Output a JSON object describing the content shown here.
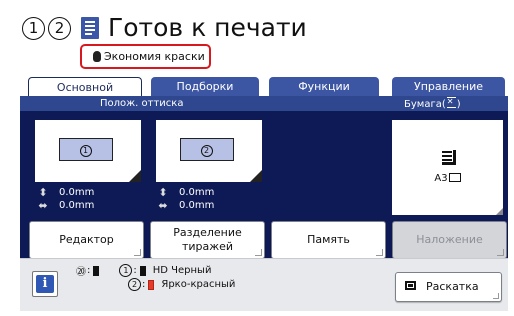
{
  "header": {
    "number_1": "1",
    "number_2": "2",
    "title": "Готов к печати",
    "eco_label": "Экономия краски",
    "doc_icon": "document-lines-icon",
    "eco_icon": "ink-drop-icon"
  },
  "tabs": [
    {
      "label": "Основной",
      "active": true
    },
    {
      "label": "Подборки",
      "active": false
    },
    {
      "label": "Функции",
      "active": false
    },
    {
      "label": "Управление",
      "active": false
    }
  ],
  "panel": {
    "position_header": "Полож. оттиска",
    "paper_header": "Бумага(",
    "paper_header_end": ")",
    "drum_1": {
      "number": "1",
      "vertical_offset": "0.0mm",
      "horizontal_offset": "0.0mm"
    },
    "drum_2": {
      "number": "2",
      "vertical_offset": "0.0mm",
      "horizontal_offset": "0.0mm"
    },
    "paper_size": "A3"
  },
  "buttons": [
    {
      "label": "Редактор",
      "enabled": true
    },
    {
      "label": "Разделение тиражей",
      "enabled": true
    },
    {
      "label": "Память",
      "enabled": true
    },
    {
      "label": "Наложение",
      "enabled": false
    }
  ],
  "status": {
    "info_icon": "info-icon",
    "ink_1_number": "1",
    "ink_1_name": "HD Черный",
    "ink_1_color": "#111111",
    "ink_2_number": "2",
    "ink_2_name": "Ярко-красный",
    "ink_2_color": "#e53b2a",
    "raskatka_label": "Раскатка"
  },
  "colors": {
    "tab_blue": "#3d56a3",
    "panel_navy": "#0e1a56",
    "highlight_red": "#d8181f",
    "drum_card": "#b7c1e5"
  }
}
